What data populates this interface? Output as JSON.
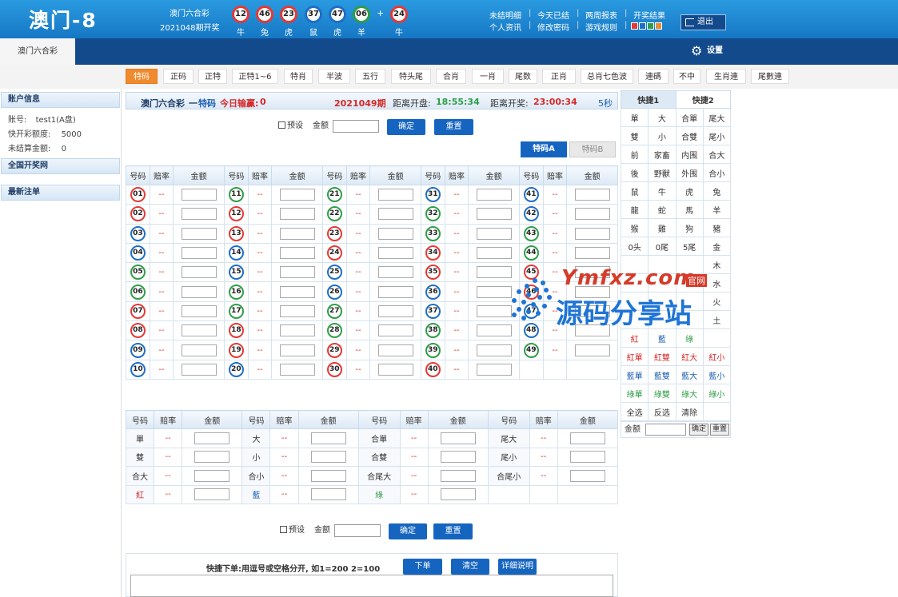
{
  "header": {
    "logo": "澳门-8",
    "lottery_name": "澳门六合彩",
    "period": "2021048期开奖",
    "balls": [
      {
        "num": "12",
        "zodiac": "牛",
        "color": "red"
      },
      {
        "num": "46",
        "zodiac": "兔",
        "color": "red"
      },
      {
        "num": "23",
        "zodiac": "虎",
        "color": "red"
      },
      {
        "num": "37",
        "zodiac": "鼠",
        "color": "blue"
      },
      {
        "num": "47",
        "zodiac": "虎",
        "color": "blue"
      },
      {
        "num": "06",
        "zodiac": "羊",
        "color": "green"
      },
      {
        "num": "24",
        "zodiac": "牛",
        "color": "red"
      }
    ],
    "plus": "+",
    "links": {
      "unsettled": "未结明细",
      "settled_today": "今天已结",
      "two_week": "两周报表",
      "results": "开奖结果",
      "personal": "个人资讯",
      "change_pwd": "修改密码",
      "rules": "游戏规则"
    },
    "sep": "|",
    "skin_colors": [
      "#e53935",
      "#1e6fc7",
      "#2e9e48",
      "#f08a2e"
    ],
    "logout": "退出"
  },
  "nav": {
    "active_tab": "澳门六合彩",
    "settings": "设置"
  },
  "subnav": [
    "特码",
    "正码",
    "正特",
    "正特1~6",
    "特肖",
    "半波",
    "五行",
    "特头尾",
    "合肖",
    "一肖",
    "尾数",
    "正肖",
    "总肖七色波",
    "連碼",
    "不中",
    "生肖連",
    "尾數連"
  ],
  "sidebar": {
    "account_title": "账户信息",
    "account_label": "账号:",
    "account_value": "test1(A盘)",
    "quota_label": "快开彩额度:",
    "quota_value": "5000",
    "unsettled_label": "未结算金额:",
    "unsettled_value": "0",
    "national_results": "全国开奖网",
    "latest_orders": "最新注单"
  },
  "main": {
    "lottery": "澳门六合彩",
    "dash": "一",
    "play": "特码",
    "today_label": "今日输赢:",
    "today_value": "0",
    "period": "2021049期",
    "close_label": "距离开盘:",
    "close_time": "18:55:34",
    "draw_label": "距离开奖:",
    "draw_time": "23:00:34",
    "refresh": "5秒",
    "preset": "预设",
    "amount": "金额",
    "confirm": "确定",
    "reset": "重置",
    "tab_a": "特码A",
    "tab_b": "特码B",
    "col_num": "号码",
    "col_odds": "赔率",
    "col_amount": "金额",
    "odds_placeholder": "--"
  },
  "numbers": [
    [
      {
        "n": "01",
        "c": "r"
      },
      {
        "n": "11",
        "c": "g"
      },
      {
        "n": "21",
        "c": "g"
      },
      {
        "n": "31",
        "c": "b"
      },
      {
        "n": "41",
        "c": "b"
      }
    ],
    [
      {
        "n": "02",
        "c": "r"
      },
      {
        "n": "12",
        "c": "r"
      },
      {
        "n": "22",
        "c": "g"
      },
      {
        "n": "32",
        "c": "g"
      },
      {
        "n": "42",
        "c": "b"
      }
    ],
    [
      {
        "n": "03",
        "c": "b"
      },
      {
        "n": "13",
        "c": "r"
      },
      {
        "n": "23",
        "c": "r"
      },
      {
        "n": "33",
        "c": "g"
      },
      {
        "n": "43",
        "c": "g"
      }
    ],
    [
      {
        "n": "04",
        "c": "b"
      },
      {
        "n": "14",
        "c": "b"
      },
      {
        "n": "24",
        "c": "r"
      },
      {
        "n": "34",
        "c": "r"
      },
      {
        "n": "44",
        "c": "g"
      }
    ],
    [
      {
        "n": "05",
        "c": "g"
      },
      {
        "n": "15",
        "c": "b"
      },
      {
        "n": "25",
        "c": "b"
      },
      {
        "n": "35",
        "c": "r"
      },
      {
        "n": "45",
        "c": "r"
      }
    ],
    [
      {
        "n": "06",
        "c": "g"
      },
      {
        "n": "16",
        "c": "g"
      },
      {
        "n": "26",
        "c": "b"
      },
      {
        "n": "36",
        "c": "b"
      },
      {
        "n": "46",
        "c": "r"
      }
    ],
    [
      {
        "n": "07",
        "c": "r"
      },
      {
        "n": "17",
        "c": "g"
      },
      {
        "n": "27",
        "c": "g"
      },
      {
        "n": "37",
        "c": "b"
      },
      {
        "n": "47",
        "c": "b"
      }
    ],
    [
      {
        "n": "08",
        "c": "r"
      },
      {
        "n": "18",
        "c": "r"
      },
      {
        "n": "28",
        "c": "g"
      },
      {
        "n": "38",
        "c": "g"
      },
      {
        "n": "48",
        "c": "b"
      }
    ],
    [
      {
        "n": "09",
        "c": "b"
      },
      {
        "n": "19",
        "c": "r"
      },
      {
        "n": "29",
        "c": "r"
      },
      {
        "n": "39",
        "c": "g"
      },
      {
        "n": "49",
        "c": "g"
      }
    ],
    [
      {
        "n": "10",
        "c": "b"
      },
      {
        "n": "20",
        "c": "b"
      },
      {
        "n": "30",
        "c": "r"
      },
      {
        "n": "40",
        "c": "r"
      },
      null
    ]
  ],
  "props": [
    [
      {
        "t": "單",
        "c": ""
      },
      {
        "t": "大",
        "c": ""
      },
      {
        "t": "合單",
        "c": ""
      },
      {
        "t": "尾大",
        "c": ""
      }
    ],
    [
      {
        "t": "雙",
        "c": ""
      },
      {
        "t": "小",
        "c": ""
      },
      {
        "t": "合雙",
        "c": ""
      },
      {
        "t": "尾小",
        "c": ""
      }
    ],
    [
      {
        "t": "合大",
        "c": ""
      },
      {
        "t": "合小",
        "c": ""
      },
      {
        "t": "合尾大",
        "c": ""
      },
      {
        "t": "合尾小",
        "c": ""
      }
    ],
    [
      {
        "t": "紅",
        "c": "#d62828"
      },
      {
        "t": "藍",
        "c": "#1e5fb0"
      },
      {
        "t": "綠",
        "c": "#2e9e48"
      },
      null
    ]
  ],
  "quick": {
    "tab1": "快捷1",
    "tab2": "快捷2",
    "rows": [
      [
        {
          "t": "單"
        },
        {
          "t": "大"
        },
        {
          "t": "合單"
        },
        {
          "t": "尾大"
        }
      ],
      [
        {
          "t": "雙"
        },
        {
          "t": "小"
        },
        {
          "t": "合雙"
        },
        {
          "t": "尾小"
        }
      ],
      [
        {
          "t": "前"
        },
        {
          "t": "家畜"
        },
        {
          "t": "内围"
        },
        {
          "t": "合大"
        }
      ],
      [
        {
          "t": "後"
        },
        {
          "t": "野獸"
        },
        {
          "t": "外围"
        },
        {
          "t": "合小"
        }
      ],
      [
        {
          "t": "鼠"
        },
        {
          "t": "牛"
        },
        {
          "t": "虎"
        },
        {
          "t": "兔"
        }
      ],
      [
        {
          "t": "龍"
        },
        {
          "t": "蛇"
        },
        {
          "t": "馬"
        },
        {
          "t": "羊"
        }
      ],
      [
        {
          "t": "猴"
        },
        {
          "t": "雞"
        },
        {
          "t": "狗"
        },
        {
          "t": "豬"
        }
      ],
      [
        {
          "t": "0头"
        },
        {
          "t": "0尾"
        },
        {
          "t": "5尾"
        },
        {
          "t": "金"
        }
      ],
      [
        {
          "t": ""
        },
        {
          "t": ""
        },
        {
          "t": ""
        },
        {
          "t": "木"
        }
      ],
      [
        {
          "t": ""
        },
        {
          "t": ""
        },
        {
          "t": ""
        },
        {
          "t": "水"
        }
      ],
      [
        {
          "t": ""
        },
        {
          "t": ""
        },
        {
          "t": ""
        },
        {
          "t": "火"
        }
      ],
      [
        {
          "t": ""
        },
        {
          "t": ""
        },
        {
          "t": ""
        },
        {
          "t": "土"
        }
      ],
      [
        {
          "t": "紅",
          "c": "#d62828"
        },
        {
          "t": "藍",
          "c": "#1e5fb0"
        },
        {
          "t": "綠",
          "c": "#2e9e48"
        },
        {
          "t": ""
        }
      ],
      [
        {
          "t": "紅單",
          "c": "#d62828"
        },
        {
          "t": "紅雙",
          "c": "#d62828"
        },
        {
          "t": "紅大",
          "c": "#d62828"
        },
        {
          "t": "紅小",
          "c": "#d62828"
        }
      ],
      [
        {
          "t": "藍單",
          "c": "#1e5fb0"
        },
        {
          "t": "藍雙",
          "c": "#1e5fb0"
        },
        {
          "t": "藍大",
          "c": "#1e5fb0"
        },
        {
          "t": "藍小",
          "c": "#1e5fb0"
        }
      ],
      [
        {
          "t": "綠單",
          "c": "#2e9e48"
        },
        {
          "t": "綠雙",
          "c": "#2e9e48"
        },
        {
          "t": "綠大",
          "c": "#2e9e48"
        },
        {
          "t": "綠小",
          "c": "#2e9e48"
        }
      ],
      [
        {
          "t": "全选"
        },
        {
          "t": "反选"
        },
        {
          "t": "清除"
        },
        {
          "t": ""
        }
      ]
    ],
    "amount": "金额",
    "confirm": "确定",
    "reset": "重置"
  },
  "fast": {
    "label": "快捷下单:用逗号或空格分开, 如1=200 2=100",
    "order": "下单",
    "clear": "清空",
    "help": "详细说明"
  },
  "watermark": {
    "site": "Ymfxz.com",
    "badge": "官网",
    "name": "源码分享站"
  }
}
